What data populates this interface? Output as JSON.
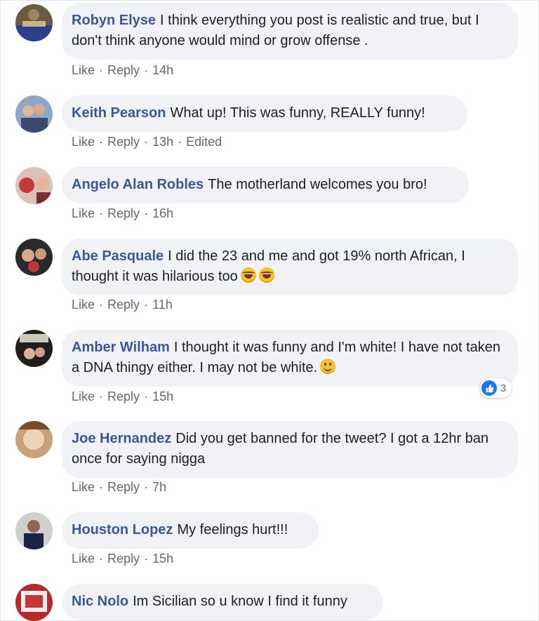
{
  "actions": {
    "like": "Like",
    "reply": "Reply",
    "sep": "·"
  },
  "comments": [
    {
      "author": "Robyn Elyse",
      "text": "I think everything you post is realistic and true, but I don't think anyone would mind or grow offense .",
      "time": "14h"
    },
    {
      "author": "Keith Pearson",
      "text": "What up! This was funny, REALLY funny!",
      "time": "13h",
      "edited": "Edited"
    },
    {
      "author": "Angelo Alan Robles",
      "text": "The motherland welcomes you bro!",
      "time": "16h"
    },
    {
      "author": "Abe Pasquale",
      "text": "I did the 23 and me and got 19% north African, I thought it was hilarious too",
      "time": "11h",
      "emoji": [
        "laughing-crying-emoji",
        "laughing-crying-emoji"
      ]
    },
    {
      "author": "Amber Wilham",
      "text": "I thought it was funny and I'm white! I have not taken a DNA thingy either. I may not be white.",
      "time": "15h",
      "emoji": [
        "smiley-emoji"
      ],
      "reaction_count": "3"
    },
    {
      "author": "Joe Hernandez",
      "text": "Did you get banned for the tweet? I got a 12hr ban once for saying nigga",
      "time": "7h"
    },
    {
      "author": "Houston Lopez",
      "text": "My feelings hurt!!!",
      "time": "15h"
    },
    {
      "author": "Nic Nolo",
      "text": "Im Sicilian so u know I find it funny"
    }
  ],
  "colors": {
    "author": "#385898",
    "bubble": "#f0f2f5",
    "meta": "#65676b",
    "like_blue": "#1877f2"
  }
}
